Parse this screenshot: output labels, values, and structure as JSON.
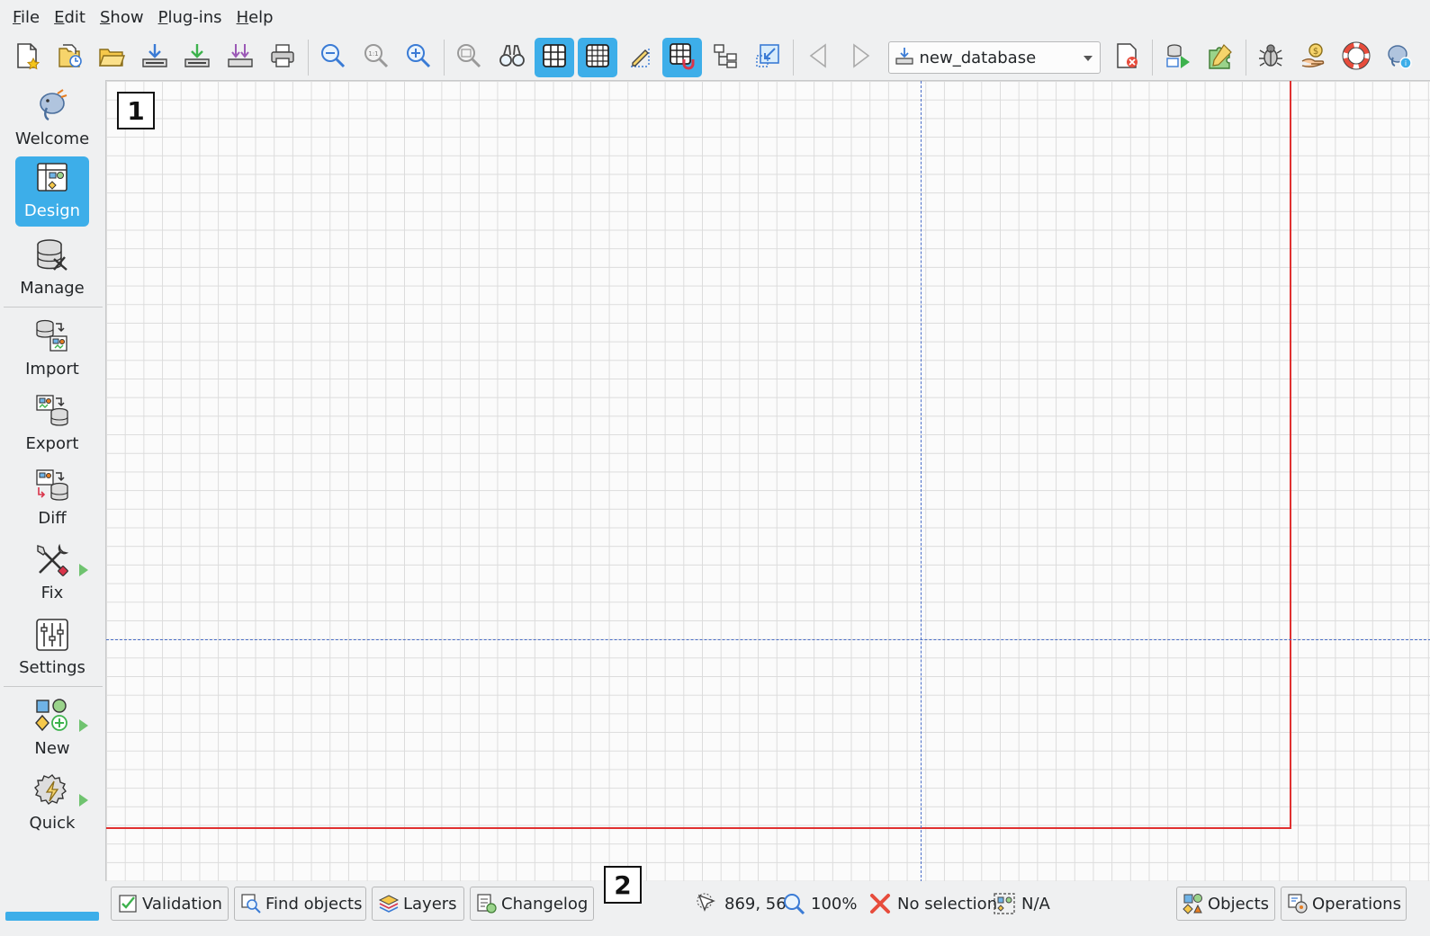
{
  "menu": [
    {
      "first": "F",
      "rest": "ile"
    },
    {
      "first": "E",
      "rest": "dit"
    },
    {
      "first": "S",
      "rest": "how"
    },
    {
      "first": "P",
      "rest": "lug-ins"
    },
    {
      "first": "H",
      "rest": "elp"
    }
  ],
  "toolbar": {
    "database_combo": "new_database",
    "icons": [
      "new-model-icon",
      "recent-models-icon",
      "open-model-icon",
      "save-icon",
      "save-as-icon",
      "save-all-icon",
      "print-icon",
      "zoom-out-icon",
      "zoom-normal-icon",
      "zoom-in-icon",
      "overview-icon",
      "find-icon",
      "show-grid-icon",
      "align-to-grid-icon",
      "page-delimiters-icon",
      "magnetic-grid-icon",
      "arrange-objects-icon",
      "expand-canvas-icon",
      "previous-model-icon",
      "next-model-icon",
      "database-combo",
      "close-model-icon",
      "execute-icon",
      "plugins-icon",
      "bug-report-icon",
      "donate-icon",
      "support-icon",
      "about-icon"
    ],
    "active": [
      "show-grid-icon",
      "align-to-grid-icon",
      "magnetic-grid-icon"
    ]
  },
  "sidebar": {
    "items": [
      {
        "label": "Welcome",
        "icon": "welcome-icon",
        "active": false,
        "has_arrow": false
      },
      {
        "label": "Design",
        "icon": "design-icon",
        "active": true,
        "has_arrow": false
      },
      {
        "label": "Manage",
        "icon": "manage-icon",
        "active": false,
        "has_arrow": false
      },
      {
        "label": "Import",
        "icon": "import-icon",
        "active": false,
        "has_arrow": false
      },
      {
        "label": "Export",
        "icon": "export-icon",
        "active": false,
        "has_arrow": false
      },
      {
        "label": "Diff",
        "icon": "diff-icon",
        "active": false,
        "has_arrow": false
      },
      {
        "label": "Fix",
        "icon": "fix-icon",
        "active": false,
        "has_arrow": true
      },
      {
        "label": "Settings",
        "icon": "settings-icon",
        "active": false,
        "has_arrow": false
      },
      {
        "label": "New",
        "icon": "new-object-icon",
        "active": false,
        "has_arrow": true
      },
      {
        "label": "Quick",
        "icon": "quick-actions-icon",
        "active": false,
        "has_arrow": true
      }
    ]
  },
  "canvas": {
    "marker1": "1",
    "marker2": "2"
  },
  "statusbar": {
    "validation": "Validation",
    "find_objects": "Find objects",
    "layers": "Layers",
    "changelog": "Changelog",
    "position": "869, 56",
    "zoom": "100%",
    "selection": "No selection",
    "selection_detail": "N/A",
    "objects": "Objects",
    "operations": "Operations"
  },
  "colors": {
    "accent": "#3daee9",
    "page_border": "#e03030",
    "guide": "#4a6ec9",
    "background": "#eff0f1"
  }
}
